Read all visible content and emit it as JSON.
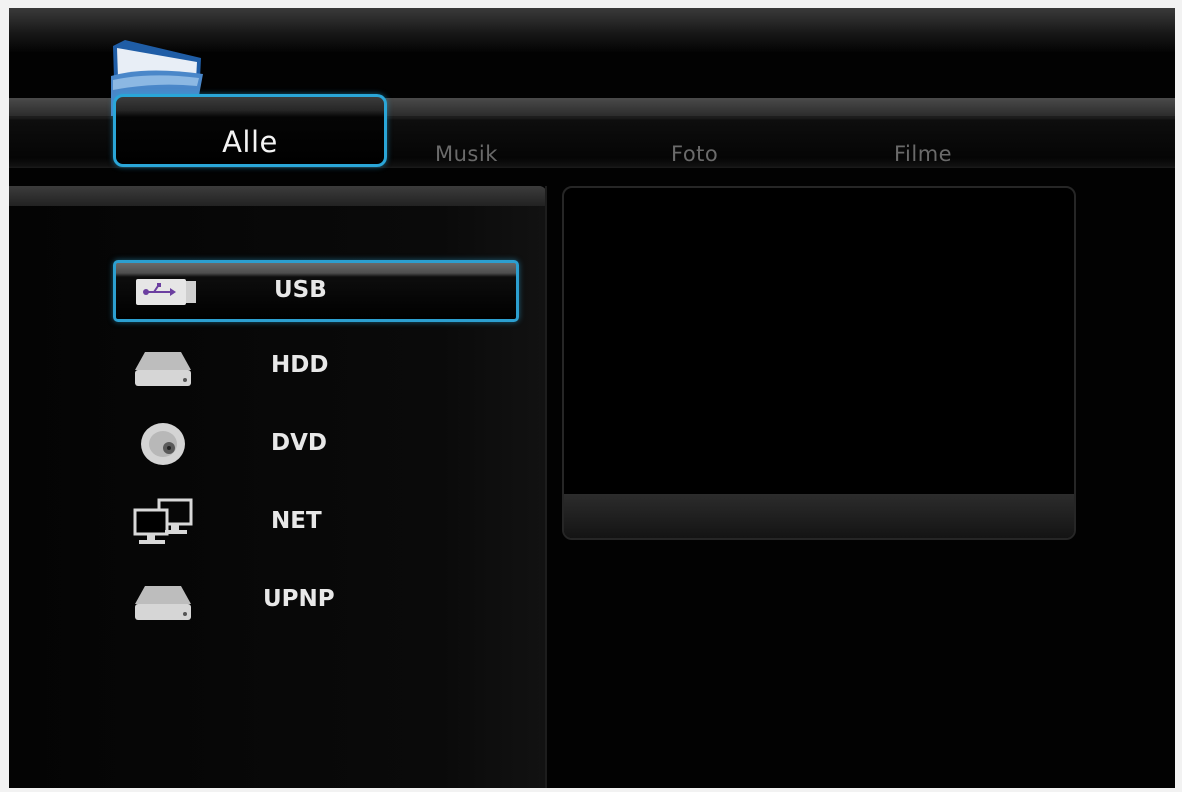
{
  "tabs": [
    {
      "label": "Alle",
      "active": true
    },
    {
      "label": "Musik",
      "active": false
    },
    {
      "label": "Foto",
      "active": false
    },
    {
      "label": "Filme",
      "active": false
    }
  ],
  "sources": [
    {
      "label": "USB",
      "icon": "usb-icon",
      "selected": true
    },
    {
      "label": "HDD",
      "icon": "hdd-icon",
      "selected": false
    },
    {
      "label": "DVD",
      "icon": "dvd-icon",
      "selected": false
    },
    {
      "label": "NET",
      "icon": "network-icon",
      "selected": false
    },
    {
      "label": "UPNP",
      "icon": "upnp-icon",
      "selected": false
    }
  ],
  "colors": {
    "highlight": "#2aa6d8",
    "background": "#020202",
    "inactive_tab_text": "#6a6a6a",
    "item_text": "#e8e8e8"
  }
}
